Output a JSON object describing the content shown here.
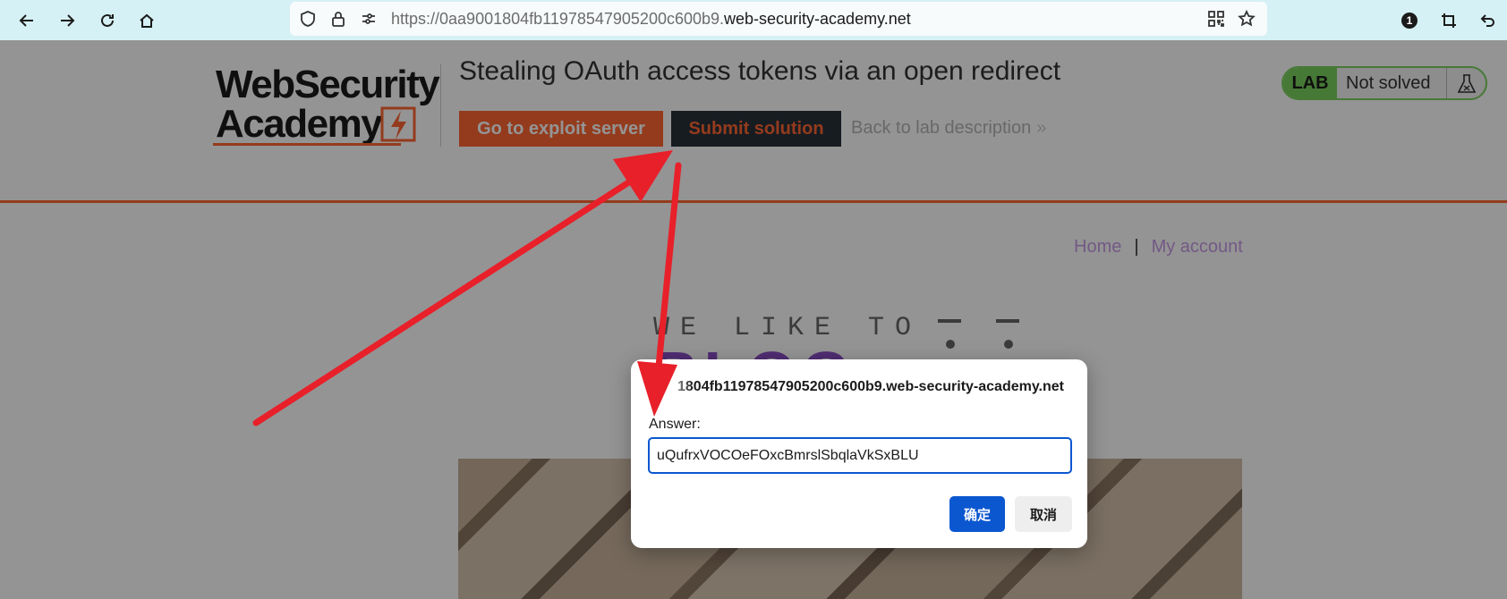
{
  "browser": {
    "url_prefix": "https://0aa9001804fb11978547905200c600b9.",
    "url_domain": "web-security-academy.net",
    "notification_count": "1"
  },
  "logo": {
    "line1": "WebSecurity",
    "line2": "Academy"
  },
  "lab": {
    "title": "Stealing OAuth access tokens via an open redirect",
    "exploit_button": "Go to exploit server",
    "submit_button": "Submit solution",
    "back_link": "Back to lab description",
    "badge_label": "LAB",
    "status": "Not solved"
  },
  "nav": {
    "home": "Home",
    "separator": "|",
    "account": "My account"
  },
  "blog_banner": {
    "small": "WE LIKE TO",
    "big": "BLOG"
  },
  "dialog": {
    "origin": "1804fb11978547905200c600b9.web-security-academy.net",
    "prompt": "Answer:",
    "answer_value": "uQufrxVOCOeFOxcBmrslSbqlaVkSxBLU",
    "ok_label": "确定",
    "cancel_label": "取消"
  },
  "colors": {
    "accent_orange": "#ff6633",
    "dark_button": "#29313a",
    "lab_green": "#7bd15e",
    "dialog_blue": "#0b57d0",
    "annotation_red": "#e8202a"
  },
  "icons": [
    "back-icon",
    "forward-icon",
    "reload-icon",
    "home-icon",
    "shield-icon",
    "lock-icon",
    "permissions-icon",
    "qr-code-icon",
    "bookmark-star-icon",
    "extension-badge-icon",
    "crop-icon",
    "undo-icon",
    "flask-icon",
    "chevron-double-right-icon"
  ]
}
